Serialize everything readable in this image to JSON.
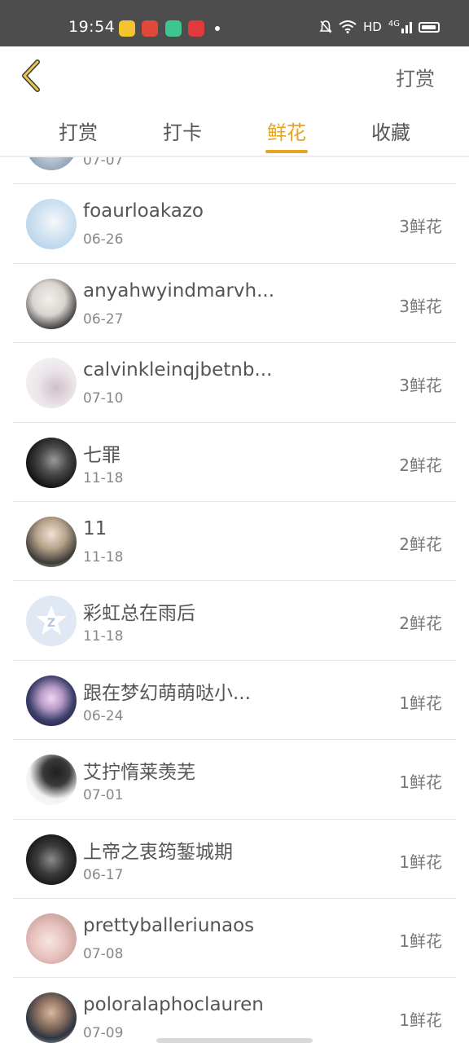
{
  "status_bar": {
    "time": "19:54",
    "network": "HD",
    "signal": "4G",
    "icons": [
      "bell-muted-icon",
      "wifi-icon",
      "signal-icon",
      "battery-icon"
    ]
  },
  "header": {
    "action_label": "打赏",
    "accent_color": "#e8a421"
  },
  "tabs": [
    {
      "label": "打赏",
      "active": false
    },
    {
      "label": "打卡",
      "active": false
    },
    {
      "label": "鲜花",
      "active": true
    },
    {
      "label": "收藏",
      "active": false
    }
  ],
  "items": [
    {
      "name": "",
      "date": "07-07",
      "count": ""
    },
    {
      "name": "foaurloakazo",
      "date": "06-26",
      "count": "3鲜花"
    },
    {
      "name": "anyahwyindmarvh...",
      "date": "06-27",
      "count": "3鲜花"
    },
    {
      "name": "calvinkleinqjbetnb...",
      "date": "07-10",
      "count": "3鲜花"
    },
    {
      "name": "七罪",
      "date": "11-18",
      "count": "2鲜花"
    },
    {
      "name": "11",
      "date": "11-18",
      "count": "2鲜花"
    },
    {
      "name": "彩虹总在雨后",
      "date": "11-18",
      "count": "2鲜花"
    },
    {
      "name": "跟在梦幻萌萌哒小...",
      "date": "06-24",
      "count": "1鲜花"
    },
    {
      "name": "艾拧惰莱羡芜",
      "date": "07-01",
      "count": "1鲜花"
    },
    {
      "name": "上帝之衷筠錾城期",
      "date": "06-17",
      "count": "1鲜花"
    },
    {
      "name": "prettyballeriunaos",
      "date": "07-08",
      "count": "1鲜花"
    },
    {
      "name": "poloralaphoclauren",
      "date": "07-09",
      "count": "1鲜花"
    }
  ]
}
